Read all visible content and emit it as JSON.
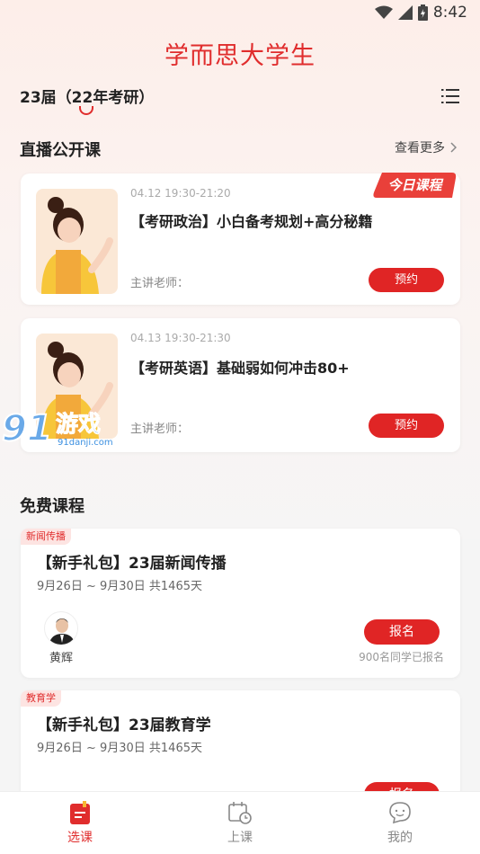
{
  "status_bar": {
    "time": "8:42"
  },
  "app_title": "学而思大学生",
  "grade_selector": "23届（22年考研）",
  "live_section": {
    "title": "直播公开课",
    "see_more": "查看更多",
    "today_badge": "今日课程",
    "courses": [
      {
        "time": "04.12 19:30-21:20",
        "name": "【考研政治】小白备考规划+高分秘籍",
        "teacher_label": "主讲老师：",
        "button": "预约"
      },
      {
        "time": "04.13 19:30-21:30",
        "name": "【考研英语】基础弱如何冲击80+",
        "teacher_label": "主讲老师：",
        "button": "预约"
      }
    ]
  },
  "free_section": {
    "title": "免费课程",
    "courses": [
      {
        "tag": "新闻传播",
        "name": "【新手礼包】23届新闻传播",
        "date": "9月26日 ~ 9月30日 共1465天",
        "teacher": "黄辉",
        "button": "报名",
        "enrolled": "900名同学已报名"
      },
      {
        "tag": "教育学",
        "name": "【新手礼包】23届教育学",
        "date": "9月26日 ~ 9月30日 共1465天",
        "button": "报名"
      }
    ]
  },
  "watermark": {
    "text": "91游戏",
    "url": "91danji.com"
  },
  "bottom_nav": [
    {
      "label": "选课",
      "icon": "course-select-icon",
      "active": true
    },
    {
      "label": "上课",
      "icon": "calendar-clock-icon",
      "active": false
    },
    {
      "label": "我的",
      "icon": "chat-face-icon",
      "active": false
    }
  ],
  "colors": {
    "accent": "#e02d2d",
    "button": "#e02525",
    "tag_bg": "#fde4e2"
  }
}
